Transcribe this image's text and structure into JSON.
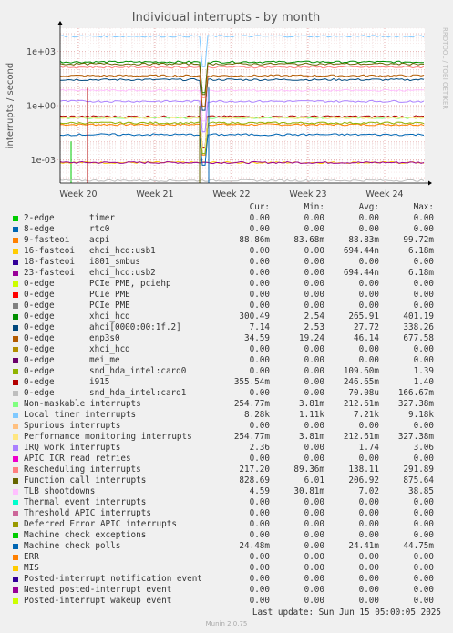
{
  "chart_data": {
    "type": "line",
    "title": "Individual interrupts - by month",
    "ylabel": "interrupts / second",
    "yscale": "log",
    "y_ticks": [
      {
        "value": 1000,
        "label": "1e+03"
      },
      {
        "value": 1,
        "label": "1e+00"
      },
      {
        "value": 0.001,
        "label": "1e-03"
      }
    ],
    "ylim": [
      5e-05,
      20000
    ],
    "x_ticks": [
      "Week 20",
      "Week 21",
      "Week 22",
      "Week 23",
      "Week 24"
    ],
    "grid": true,
    "legend_position": "bottom",
    "series": [
      {
        "name": "2-edge",
        "device": "timer",
        "color": "#00cc00",
        "level": 0
      },
      {
        "name": "8-edge",
        "device": "rtc0",
        "color": "#0066b3",
        "level": 0
      },
      {
        "name": "9-fasteoi",
        "device": "acpi",
        "color": "#ff8000",
        "level": 0.0889
      },
      {
        "name": "16-fasteoi",
        "device": "ehci_hcd:usb1",
        "color": "#ffcc00",
        "level": 0.000694
      },
      {
        "name": "18-fasteoi",
        "device": "i801_smbus",
        "color": "#330099",
        "level": 0
      },
      {
        "name": "23-fasteoi",
        "device": "ehci_hcd:usb2",
        "color": "#990099",
        "level": 0.000694
      },
      {
        "name": "0-edge",
        "device": "PCIe PME, pciehp",
        "color": "#ccff00",
        "level": 0
      },
      {
        "name": "0-edge",
        "device": "PCIe PME",
        "color": "#ff0000",
        "level": 0
      },
      {
        "name": "0-edge",
        "device": "PCIe PME",
        "color": "#808080",
        "level": 0
      },
      {
        "name": "0-edge",
        "device": "xhci_hcd",
        "color": "#008f00",
        "level": 265.91
      },
      {
        "name": "0-edge",
        "device": "ahci[0000:00:1f.2]",
        "color": "#00487d",
        "level": 27.72
      },
      {
        "name": "0-edge",
        "device": "enp3s0",
        "color": "#b35a00",
        "level": 46.14
      },
      {
        "name": "0-edge",
        "device": "xhci_hcd",
        "color": "#b38f00",
        "level": 0
      },
      {
        "name": "0-edge",
        "device": "mei_me",
        "color": "#6b006b",
        "level": 0
      },
      {
        "name": "0-edge",
        "device": "snd_hda_intel:card0",
        "color": "#8fb300",
        "level": 0.1096
      },
      {
        "name": "0-edge",
        "device": "i915",
        "color": "#b30000",
        "level": 0.2466
      },
      {
        "name": "0-edge",
        "device": "snd_hda_intel:card1",
        "color": "#bebebe",
        "level": 7e-05
      },
      {
        "name": "Non-maskable interrupts",
        "device": "",
        "color": "#80ff80",
        "level": 0.2126
      },
      {
        "name": "Local timer interrupts",
        "device": "",
        "color": "#80c9ff",
        "level": 7210
      },
      {
        "name": "Spurious interrupts",
        "device": "",
        "color": "#ffc080",
        "level": 0
      },
      {
        "name": "Performance monitoring interrupts",
        "device": "",
        "color": "#ffe680",
        "level": 0.2126
      },
      {
        "name": "IRQ work interrupts",
        "device": "",
        "color": "#aa80ff",
        "level": 1.74
      },
      {
        "name": "APIC ICR read retries",
        "device": "",
        "color": "#ee00cc",
        "level": 0
      },
      {
        "name": "Rescheduling interrupts",
        "device": "",
        "color": "#ff8080",
        "level": 138.11
      },
      {
        "name": "Function call interrupts",
        "device": "",
        "color": "#666600",
        "level": 206.92
      },
      {
        "name": "TLB shootdowns",
        "device": "",
        "color": "#ffbfff",
        "level": 7.02
      },
      {
        "name": "Thermal event interrupts",
        "device": "",
        "color": "#00ffcc",
        "level": 0
      },
      {
        "name": "Threshold APIC interrupts",
        "device": "",
        "color": "#cc6699",
        "level": 0
      },
      {
        "name": "Deferred Error APIC interrupts",
        "device": "",
        "color": "#999900",
        "level": 0
      },
      {
        "name": "Machine check exceptions",
        "device": "",
        "color": "#00cc00",
        "level": 0
      },
      {
        "name": "Machine check polls",
        "device": "",
        "color": "#0066b3",
        "level": 0.02441
      },
      {
        "name": "ERR",
        "device": "",
        "color": "#ff8000",
        "level": 0
      },
      {
        "name": "MIS",
        "device": "",
        "color": "#ffcc00",
        "level": 0
      },
      {
        "name": "Posted-interrupt notification event",
        "device": "",
        "color": "#330099",
        "level": 0
      },
      {
        "name": "Nested posted-interrupt event",
        "device": "",
        "color": "#990099",
        "level": 0
      },
      {
        "name": "Posted-interrupt wakeup event",
        "device": "",
        "color": "#ccff00",
        "level": 0
      }
    ]
  },
  "side_label": "RRDTOOL / TOBI OETIKER",
  "legend": {
    "headers": {
      "cur": "Cur:",
      "min": "Min:",
      "avg": "Avg:",
      "max": "Max:"
    },
    "rows": [
      {
        "cur": "0.00",
        "min": "0.00",
        "avg": "0.00",
        "max": "0.00"
      },
      {
        "cur": "0.00",
        "min": "0.00",
        "avg": "0.00",
        "max": "0.00"
      },
      {
        "cur": "88.86m",
        "min": "83.68m",
        "avg": "88.83m",
        "max": "99.72m"
      },
      {
        "cur": "0.00",
        "min": "0.00",
        "avg": "694.44n",
        "max": "6.18m"
      },
      {
        "cur": "0.00",
        "min": "0.00",
        "avg": "0.00",
        "max": "0.00"
      },
      {
        "cur": "0.00",
        "min": "0.00",
        "avg": "694.44n",
        "max": "6.18m"
      },
      {
        "cur": "0.00",
        "min": "0.00",
        "avg": "0.00",
        "max": "0.00"
      },
      {
        "cur": "0.00",
        "min": "0.00",
        "avg": "0.00",
        "max": "0.00"
      },
      {
        "cur": "0.00",
        "min": "0.00",
        "avg": "0.00",
        "max": "0.00"
      },
      {
        "cur": "300.49",
        "min": "2.54",
        "avg": "265.91",
        "max": "401.19"
      },
      {
        "cur": "7.14",
        "min": "2.53",
        "avg": "27.72",
        "max": "338.26"
      },
      {
        "cur": "34.59",
        "min": "19.24",
        "avg": "46.14",
        "max": "677.58"
      },
      {
        "cur": "0.00",
        "min": "0.00",
        "avg": "0.00",
        "max": "0.00"
      },
      {
        "cur": "0.00",
        "min": "0.00",
        "avg": "0.00",
        "max": "0.00"
      },
      {
        "cur": "0.00",
        "min": "0.00",
        "avg": "109.60m",
        "max": "1.39"
      },
      {
        "cur": "355.54m",
        "min": "0.00",
        "avg": "246.65m",
        "max": "1.40"
      },
      {
        "cur": "0.00",
        "min": "0.00",
        "avg": "70.08u",
        "max": "166.67m"
      },
      {
        "cur": "254.77m",
        "min": "3.81m",
        "avg": "212.61m",
        "max": "327.38m"
      },
      {
        "cur": "8.28k",
        "min": "1.11k",
        "avg": "7.21k",
        "max": "9.18k"
      },
      {
        "cur": "0.00",
        "min": "0.00",
        "avg": "0.00",
        "max": "0.00"
      },
      {
        "cur": "254.77m",
        "min": "3.81m",
        "avg": "212.61m",
        "max": "327.38m"
      },
      {
        "cur": "2.36",
        "min": "0.00",
        "avg": "1.74",
        "max": "3.06"
      },
      {
        "cur": "0.00",
        "min": "0.00",
        "avg": "0.00",
        "max": "0.00"
      },
      {
        "cur": "217.20",
        "min": "89.36m",
        "avg": "138.11",
        "max": "291.89"
      },
      {
        "cur": "828.69",
        "min": "6.01",
        "avg": "206.92",
        "max": "875.64"
      },
      {
        "cur": "4.59",
        "min": "30.81m",
        "avg": "7.02",
        "max": "38.85"
      },
      {
        "cur": "0.00",
        "min": "0.00",
        "avg": "0.00",
        "max": "0.00"
      },
      {
        "cur": "0.00",
        "min": "0.00",
        "avg": "0.00",
        "max": "0.00"
      },
      {
        "cur": "0.00",
        "min": "0.00",
        "avg": "0.00",
        "max": "0.00"
      },
      {
        "cur": "0.00",
        "min": "0.00",
        "avg": "0.00",
        "max": "0.00"
      },
      {
        "cur": "24.48m",
        "min": "0.00",
        "avg": "24.41m",
        "max": "44.75m"
      },
      {
        "cur": "0.00",
        "min": "0.00",
        "avg": "0.00",
        "max": "0.00"
      },
      {
        "cur": "0.00",
        "min": "0.00",
        "avg": "0.00",
        "max": "0.00"
      },
      {
        "cur": "0.00",
        "min": "0.00",
        "avg": "0.00",
        "max": "0.00"
      },
      {
        "cur": "0.00",
        "min": "0.00",
        "avg": "0.00",
        "max": "0.00"
      },
      {
        "cur": "0.00",
        "min": "0.00",
        "avg": "0.00",
        "max": "0.00"
      }
    ]
  },
  "last_update": "Last update: Sun Jun 15 05:00:05 2025",
  "footer": "Munin 2.0.75"
}
